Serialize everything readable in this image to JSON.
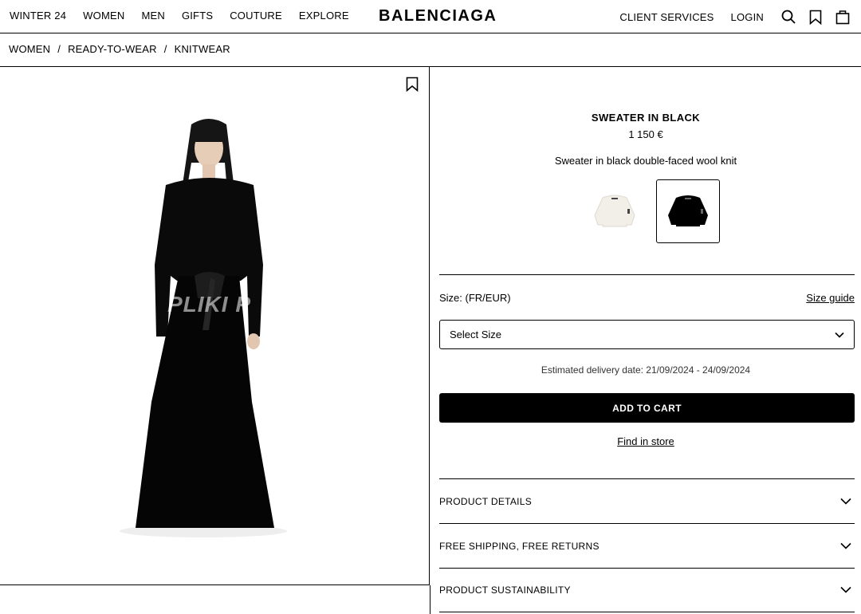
{
  "header": {
    "nav_left": [
      "WINTER 24",
      "WOMEN",
      "MEN",
      "GIFTS",
      "COUTURE",
      "EXPLORE"
    ],
    "logo": "BALENCIAGA",
    "client_services": "CLIENT SERVICES",
    "login": "LOGIN",
    "icons": [
      "search-icon",
      "bookmark-icon",
      "bag-icon"
    ]
  },
  "breadcrumb": [
    "WOMEN",
    "READY-TO-WEAR",
    "KNITWEAR"
  ],
  "image": {
    "watermark": "PLIKI P",
    "icon": "bookmark-icon"
  },
  "product": {
    "title": "SWEATER IN BLACK",
    "price": "1 150 €",
    "description": "Sweater in black double-faced wool knit",
    "swatches": [
      {
        "name": "white",
        "color": "#f2efe8",
        "selected": false
      },
      {
        "name": "black",
        "color": "#000000",
        "selected": true
      }
    ],
    "size_label": "Size: (FR/EUR)",
    "size_guide": "Size guide",
    "size_select": "Select Size",
    "delivery": "Estimated delivery date: 21/09/2024 - 24/09/2024",
    "add_to_cart": "ADD TO CART",
    "find_in_store": "Find in store",
    "accordion": [
      "PRODUCT DETAILS",
      "FREE SHIPPING, FREE RETURNS",
      "PRODUCT SUSTAINABILITY"
    ]
  }
}
